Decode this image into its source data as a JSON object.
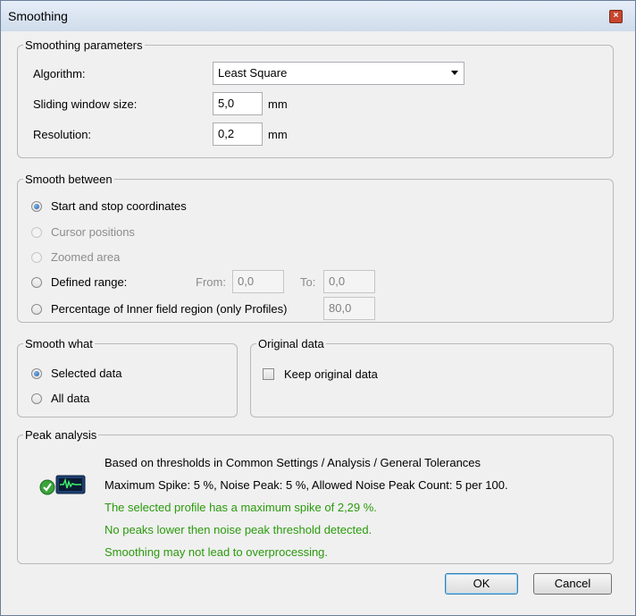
{
  "window": {
    "title": "Smoothing",
    "close_glyph": "×"
  },
  "smoothing_parameters": {
    "legend": "Smoothing parameters",
    "algorithm_label": "Algorithm:",
    "algorithm_value": "Least Square",
    "window_label": "Sliding window size:",
    "window_value": "5,0",
    "window_unit": "mm",
    "resolution_label": "Resolution:",
    "resolution_value": "0,2",
    "resolution_unit": "mm"
  },
  "smooth_between": {
    "legend": "Smooth between",
    "opt_start_stop": "Start and stop coordinates",
    "opt_cursor": "Cursor positions",
    "opt_zoomed": "Zoomed area",
    "opt_defined": "Defined range:",
    "from_label": "From:",
    "from_value": "0,0",
    "to_label": "To:",
    "to_value": "0,0",
    "opt_percentage": "Percentage of Inner field region (only Profiles)",
    "percentage_value": "80,0"
  },
  "smooth_what": {
    "legend": "Smooth what",
    "opt_selected": "Selected data",
    "opt_all": "All data"
  },
  "original_data": {
    "legend": "Original data",
    "keep_label": "Keep original data"
  },
  "peak_analysis": {
    "legend": "Peak analysis",
    "line1": "Based on thresholds in Common Settings / Analysis / General Tolerances",
    "line2": "Maximum Spike: 5 %, Noise Peak: 5 %, Allowed Noise Peak Count: 5 per 100.",
    "line3": "The selected profile has a maximum spike of 2,29 %.",
    "line4": "No peaks lower then noise peak threshold detected.",
    "line5": "Smoothing may not lead to overprocessing.",
    "status_icon": "green-check-signal-icon"
  },
  "buttons": {
    "ok": "OK",
    "cancel": "Cancel"
  }
}
